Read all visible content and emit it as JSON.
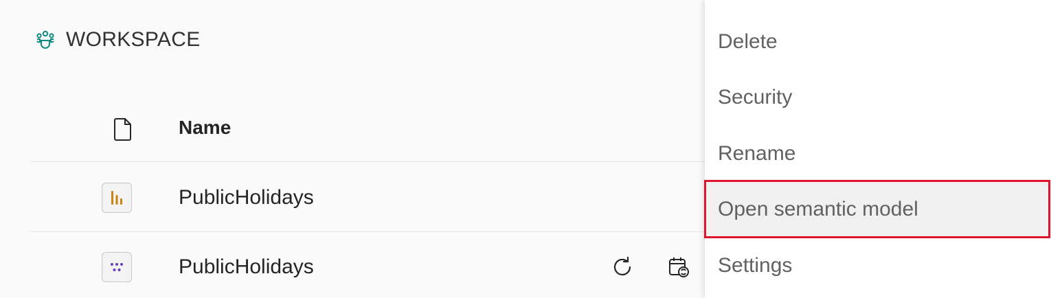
{
  "workspace": {
    "icon": "workspace-people-icon",
    "title": "WORKSPACE",
    "accent_color": "#0f8a82"
  },
  "table": {
    "header_icon": "file-icon",
    "name_header": "Name",
    "rows": [
      {
        "icon": "report-bar-chart-icon",
        "icon_color": "#c98410",
        "name": "PublicHolidays"
      },
      {
        "icon": "semantic-model-dots-icon",
        "icon_color": "#6b3fb8",
        "name": "PublicHolidays",
        "actions": [
          "refresh-icon",
          "schedule-refresh-icon"
        ]
      }
    ]
  },
  "context_menu": {
    "items": [
      {
        "label": "Delete"
      },
      {
        "label": "Security"
      },
      {
        "label": "Rename"
      },
      {
        "label": "Open semantic model",
        "highlighted": true
      },
      {
        "label": "Settings"
      }
    ],
    "highlight_color": "#e0142d"
  }
}
